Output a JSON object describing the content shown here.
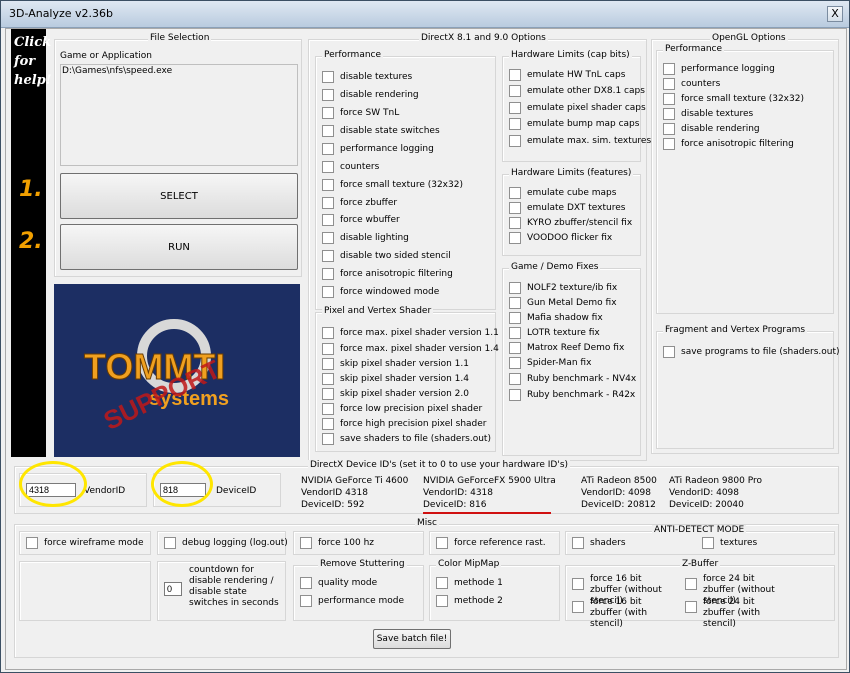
{
  "window": {
    "title": "3D-Analyze v2.36b",
    "close": "X"
  },
  "help_strip": {
    "text": "Click for help!",
    "step1": "1.",
    "step2": "2."
  },
  "file_selection": {
    "title": "File Selection",
    "label": "Game or Application",
    "path": "D:\\Games\\nfs\\speed.exe",
    "select": "SELECT",
    "run": "RUN"
  },
  "logo": {
    "brand": "TOMMTI",
    "sub": "systems",
    "stamp": "SUPPORT"
  },
  "directx": {
    "title": "DirectX 8.1 and 9.0 Options",
    "performance": {
      "title": "Performance",
      "items": [
        "disable textures",
        "disable rendering",
        "force SW TnL",
        "disable state switches",
        "performance logging",
        "counters",
        "force small texture (32x32)",
        "force zbuffer",
        "force wbuffer",
        "disable lighting",
        "disable two sided stencil",
        "force anisotropic filtering",
        "force windowed mode"
      ]
    },
    "pixel_vertex": {
      "title": "Pixel and Vertex Shader",
      "items": [
        "force max. pixel shader version 1.1",
        "force max. pixel shader version 1.4",
        "skip pixel shader version 1.1",
        "skip pixel shader version 1.4",
        "skip pixel shader version 2.0",
        "force low precision pixel shader",
        "force high precision pixel shader",
        "save shaders to file (shaders.out)"
      ]
    },
    "hw_caps": {
      "title": "Hardware Limits (cap bits)",
      "items": [
        "emulate HW TnL caps",
        "emulate other DX8.1 caps",
        "emulate pixel shader caps",
        "emulate bump map caps",
        "emulate max. sim. textures"
      ]
    },
    "hw_features": {
      "title": "Hardware Limits (features)",
      "items": [
        "emulate cube maps",
        "emulate DXT textures",
        "KYRO zbuffer/stencil fix",
        "VOODOO flicker fix"
      ]
    },
    "fixes": {
      "title": "Game / Demo Fixes",
      "items": [
        "NOLF2 texture/ib fix",
        "Gun Metal Demo fix",
        "Mafia shadow fix",
        "LOTR texture fix",
        "Matrox Reef Demo fix",
        "Spider-Man fix",
        "Ruby benchmark - NV4x",
        "Ruby benchmark - R42x"
      ]
    }
  },
  "opengl": {
    "title": "OpenGL Options",
    "performance": {
      "title": "Performance",
      "items": [
        "performance logging",
        "counters",
        "force small texture (32x32)",
        "disable textures",
        "disable rendering",
        "force anisotropic filtering"
      ]
    },
    "fragment": {
      "title": "Fragment and Vertex Programs",
      "items": [
        "save programs to file (shaders.out)"
      ]
    }
  },
  "device": {
    "title": "DirectX Device ID's (set it to 0 to use your hardware ID's)",
    "vendor_value": "4318",
    "vendor_label": "VendorID",
    "device_value": "818",
    "device_label": "DeviceID",
    "cards": [
      {
        "name": "NVIDIA GeForce Ti 4600",
        "vendor": "VendorID 4318",
        "device": "DeviceID: 592"
      },
      {
        "name": "NVIDIA GeForceFX 5900 Ultra",
        "vendor": "VendorID: 4318",
        "device": "DeviceID: 816"
      },
      {
        "name": "ATi Radeon 8500",
        "vendor": "VendorID: 4098",
        "device": "DeviceID: 20812"
      },
      {
        "name": "ATi Radeon 9800 Pro",
        "vendor": "VendorID: 4098",
        "device": "DeviceID: 20040"
      }
    ]
  },
  "misc": {
    "title": "Misc",
    "wireframe": "force wireframe mode",
    "debug": "debug logging (log.out)",
    "force100": "force 100 hz",
    "refrast": "force reference rast.",
    "antidetect": {
      "title": "ANTI-DETECT MODE",
      "shaders": "shaders",
      "textures": "textures"
    },
    "countdown": {
      "value": "0",
      "label": "countdown for disable rendering / disable state switches in seconds"
    },
    "stutter": {
      "title": "Remove Stuttering",
      "quality": "quality mode",
      "performance": "performance mode"
    },
    "mipmap": {
      "title": "Color MipMap",
      "m1": "methode 1",
      "m2": "methode 2"
    },
    "zbuffer": {
      "title": "Z-Buffer",
      "z16a": "force 16 bit zbuffer (without stencil)",
      "z24a": "force 24 bit zbuffer (without stencil)",
      "z16b": "force 16 bit zbuffer (with stencil)",
      "z24b": "force 24 bit zbuffer (with stencil)"
    },
    "save": "Save batch file!"
  },
  "colors": {
    "highlight": "#ffe600",
    "underline": "#d01010",
    "step": "#f2a000",
    "logo_bg": "#1c2e63"
  }
}
